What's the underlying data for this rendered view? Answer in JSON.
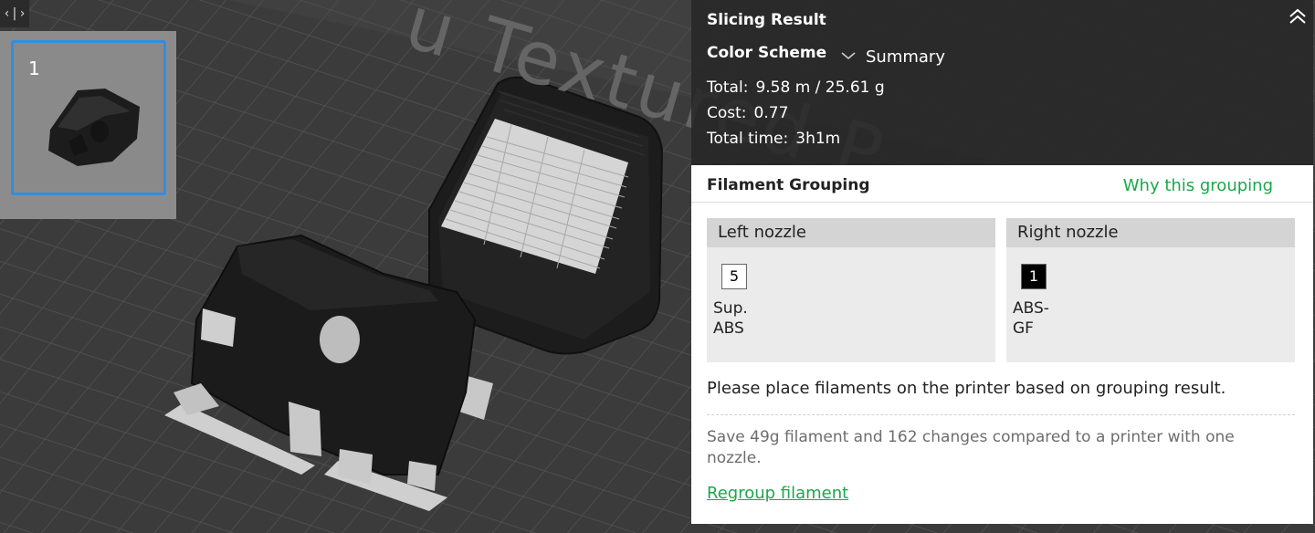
{
  "viewport": {
    "plate_text": "u Textured P",
    "collapse_toggle": "‹|›",
    "plate_number": "1"
  },
  "slicing_result": {
    "title": "Slicing Result",
    "color_scheme_label": "Color Scheme",
    "color_scheme_value": "Summary",
    "total_label": "Total:",
    "total_value": "9.58 m / 25.61 g",
    "cost_label": "Cost:",
    "cost_value": "0.77",
    "time_label": "Total time:",
    "time_value": "3h1m"
  },
  "filament_grouping": {
    "title": "Filament Grouping",
    "why_link": "Why this grouping",
    "left_nozzle": {
      "label": "Left nozzle",
      "filament_number": "5",
      "filament_name": "Sup. ABS",
      "chip_color": "#ffffff",
      "chip_text_color": "#000000"
    },
    "right_nozzle": {
      "label": "Right nozzle",
      "filament_number": "1",
      "filament_name": "ABS-GF",
      "chip_color": "#000000",
      "chip_text_color": "#ffffff"
    },
    "placement_message": "Please place filaments on the printer based on grouping result.",
    "savings_message": "Save 49g filament and 162 changes compared to a printer with one nozzle.",
    "regroup_link": "Regroup filament"
  },
  "colors": {
    "accent_green": "#1aa84a",
    "selection_blue": "#2f8fe0",
    "viewport_bg": "#3b3b3b"
  }
}
